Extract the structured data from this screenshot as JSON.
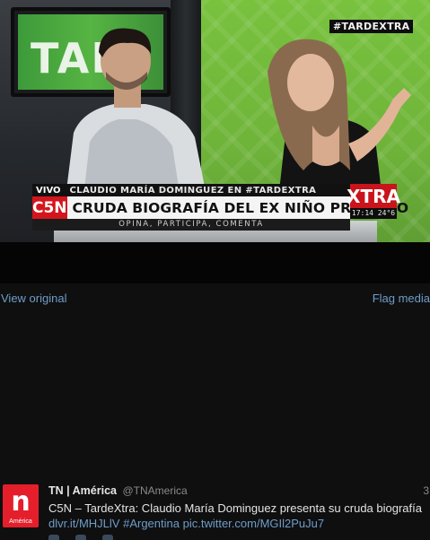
{
  "media": {
    "monitor_text": "TAR",
    "hashtag_bug": "#TARDEXTRA",
    "lower_third": {
      "live_label": "VIVO",
      "kicker": "CLAUDIO MARÍA DOMINGUEZ EN #TARDEXTRA",
      "channel_logo": "C5N",
      "headline": "CRUDA BIOGRAFÍA DEL EX NIÑO PRODIGIO",
      "subline": "OPINA, PARTICIPA, COMENTA",
      "brand": "XTRA",
      "clock": "17:14 24°6"
    }
  },
  "links": {
    "view_original": "View original",
    "flag_media": "Flag media"
  },
  "tweet": {
    "avatar_letter": "n",
    "avatar_caption": "América",
    "name": "TN | América",
    "handle": "@TNAmerica",
    "time": "3",
    "text_plain": "C5N – TardeXtra: Claudio María Dominguez presenta su cruda biografía",
    "link_1": "dlvr.it/MHJLlV",
    "hashtag": "#Argentina",
    "link_2": "pic.twitter.com/MGIl2PuJu7"
  },
  "colors": {
    "background": "#0f0f10",
    "link": "#6e9dc8",
    "c5n_red": "#d3161d",
    "studio_green": "#78c23e"
  }
}
